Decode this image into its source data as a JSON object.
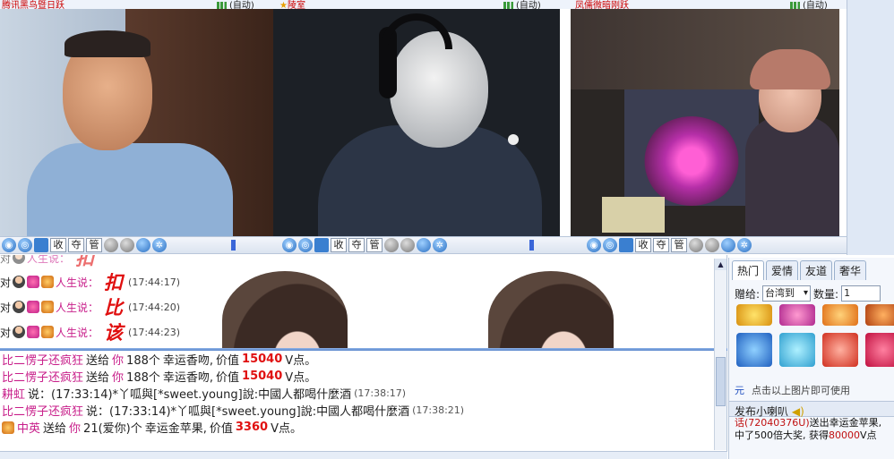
{
  "topbar": {
    "room1": "腾讯黑鸟暨日跃",
    "status1": "(自动)",
    "room2": "陵室",
    "status2": "(自动)",
    "room3": "凤儒微暗刚跃",
    "status3": "(自动)"
  },
  "controls": {
    "buttons": [
      "收",
      "夺",
      "管"
    ]
  },
  "chat_top": {
    "rows": [
      {
        "prefix": "对",
        "user": "人生说：",
        "big": "扣",
        "time": "(17:44:17)"
      },
      {
        "prefix": "对",
        "user": "人生说：",
        "big": "比",
        "time": "(17:44:20)"
      },
      {
        "prefix": "对",
        "user": "人生说：",
        "big": "该",
        "time": "(17:44:23)"
      }
    ]
  },
  "chat_bottom": {
    "lines": [
      {
        "user": "比二愣子还疯狂",
        "verb": "送给",
        "target": "你",
        "qty": "188个",
        "item": "幸运香吻,",
        "value_label": "价值",
        "value": "15040",
        "unit": "V点。"
      },
      {
        "user": "比二愣子还疯狂",
        "verb": "送给",
        "target": "你",
        "qty": "188个",
        "item": "幸运香吻,",
        "value_label": "价值",
        "value": "15040",
        "unit": "V点。"
      },
      {
        "user": "耕虹",
        "text": "说：(17:33:14)*丫呱與[*sweet.young]說:中國人都喝什麼酒",
        "time": "(17:38:17)"
      },
      {
        "user": "比二愣子还疯狂",
        "text": "说：(17:33:14)*丫呱與[*sweet.young]說:中國人都喝什麼酒",
        "time": "(17:38:21)"
      },
      {
        "user": "中英",
        "verb": "送给",
        "target": "你",
        "qty": "21(爱你)个",
        "item": "幸运金苹果,",
        "value_label": "价值",
        "value": "3360",
        "unit": "V点。"
      }
    ]
  },
  "gift_panel": {
    "tabs": [
      "热门",
      "爱情",
      "友道",
      "奢华"
    ],
    "give_label": "赠给:",
    "give_target": "台湾到",
    "qty_label": "数量:",
    "qty_value": "1",
    "hint_key": "元",
    "hint": "点击以上图片即可使用",
    "horn_label": "发布小喇叭",
    "horn_msg_a": "话(72040376U)",
    "horn_msg_b": "送出幸运金苹果, 中了500倍大奖, 获得",
    "horn_msg_value": "80000",
    "horn_msg_unit": "V点"
  },
  "colors": {
    "accent": "#3a66d8",
    "username": "#c81e8a",
    "value": "#e01010"
  }
}
